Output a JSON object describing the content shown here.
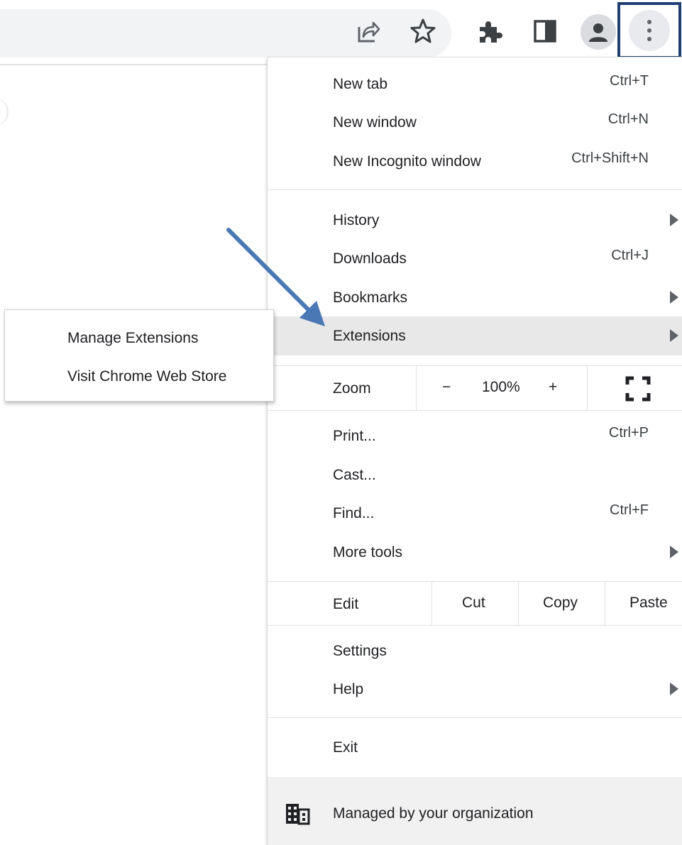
{
  "menu": {
    "groups": [
      [
        {
          "label": "New tab",
          "shortcut": "Ctrl+T"
        },
        {
          "label": "New window",
          "shortcut": "Ctrl+N"
        },
        {
          "label": "New Incognito window",
          "shortcut": "Ctrl+Shift+N"
        }
      ],
      [
        {
          "label": "History",
          "submenu": true
        },
        {
          "label": "Downloads",
          "shortcut": "Ctrl+J"
        },
        {
          "label": "Bookmarks",
          "submenu": true
        },
        {
          "label": "Extensions",
          "submenu": true,
          "highlighted": true
        }
      ]
    ],
    "zoom": {
      "label": "Zoom",
      "minus": "−",
      "value": "100%",
      "plus": "+"
    },
    "tools": [
      {
        "label": "Print...",
        "shortcut": "Ctrl+P"
      },
      {
        "label": "Cast..."
      },
      {
        "label": "Find...",
        "shortcut": "Ctrl+F"
      },
      {
        "label": "More tools",
        "submenu": true
      }
    ],
    "edit": {
      "label": "Edit",
      "cut": "Cut",
      "copy": "Copy",
      "paste": "Paste"
    },
    "settings": {
      "label": "Settings"
    },
    "help": {
      "label": "Help"
    },
    "exit": {
      "label": "Exit"
    },
    "managed": {
      "label": "Managed by your organization"
    }
  },
  "submenu": {
    "items": [
      "Manage Extensions",
      "Visit Chrome Web Store"
    ]
  },
  "toolbar": {
    "icons": [
      "share-icon",
      "star-icon",
      "puzzle-icon",
      "side-panel-icon",
      "avatar-icon",
      "more-vert-icon"
    ]
  },
  "colors": {
    "highlight": "#e8e8e8",
    "annotation_arrow": "#4a78b5",
    "annotation_box": "#1f3f73"
  }
}
